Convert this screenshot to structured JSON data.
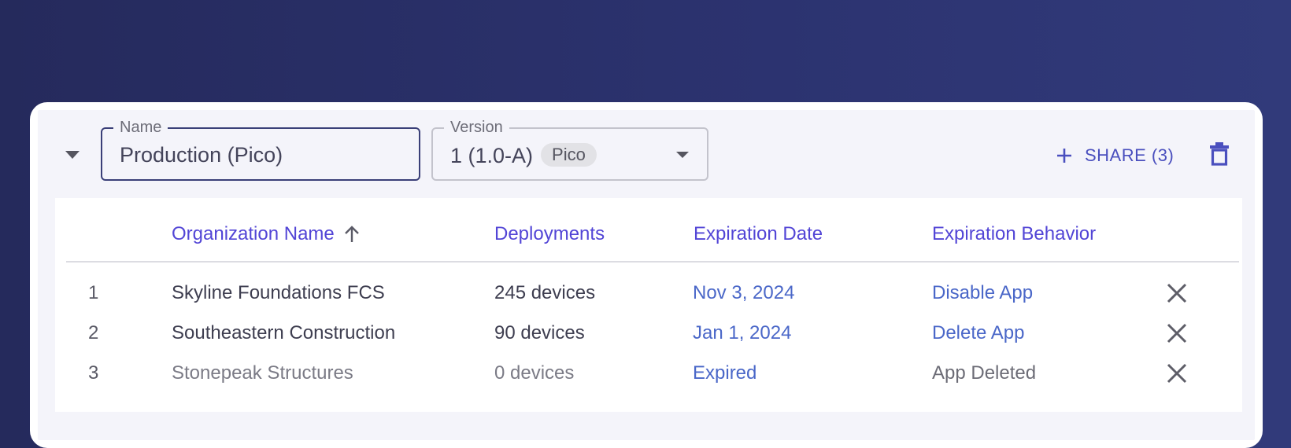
{
  "header": {
    "name_field": {
      "legend": "Name",
      "value": "Production (Pico)"
    },
    "version_field": {
      "legend": "Version",
      "value": "1 (1.0-A)",
      "chip": "Pico"
    },
    "share_button": {
      "label": "SHARE (3)"
    }
  },
  "table": {
    "columns": {
      "organization": "Organization Name",
      "deployments": "Deployments",
      "expiration_date": "Expiration Date",
      "expiration_behavior": "Expiration Behavior"
    },
    "sort": {
      "column": "organization",
      "direction": "ascending"
    },
    "rows": [
      {
        "index": "1",
        "organization": "Skyline Foundations FCS",
        "deployments": "245 devices",
        "expiration_date": "Nov 3, 2024",
        "expiration_behavior": "Disable App"
      },
      {
        "index": "2",
        "organization": "Southeastern Construction",
        "deployments": "90 devices",
        "expiration_date": "Jan 1, 2024",
        "expiration_behavior": "Delete App"
      },
      {
        "index": "3",
        "organization": "Stonepeak Structures",
        "deployments": "0 devices",
        "expiration_date": "Expired",
        "expiration_behavior": "App Deleted"
      }
    ]
  },
  "icons": {
    "collapse": "triangle-down-icon",
    "select": "chevron-down-icon",
    "share": "plus-icon",
    "delete": "trash-icon",
    "sort": "arrow-up-icon",
    "remove_row": "close-icon"
  },
  "colors": {
    "accent": "#5245d6",
    "link": "#4a67c8",
    "background": "#2c3370"
  }
}
